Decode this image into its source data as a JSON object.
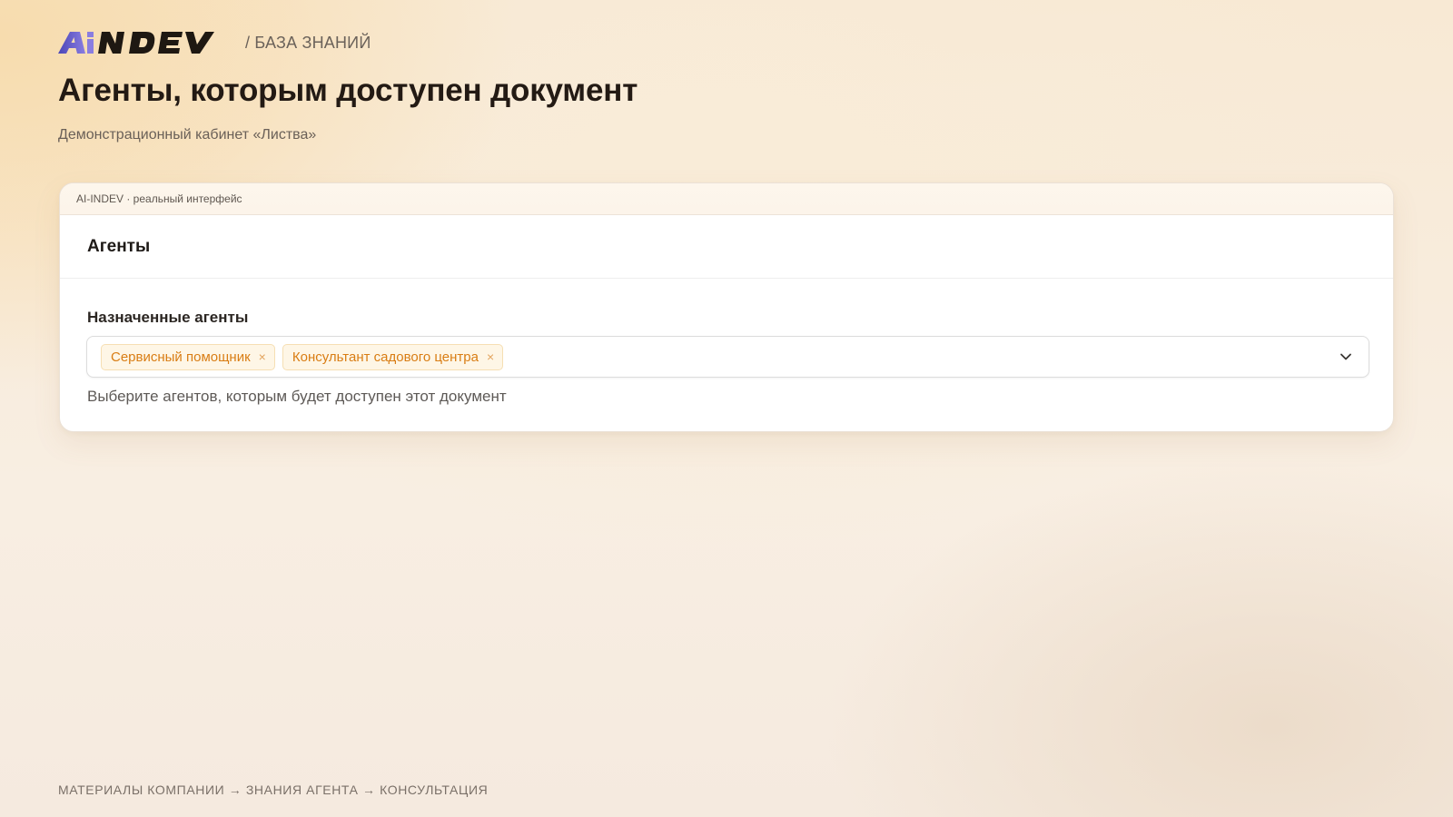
{
  "brand": {
    "logo_text": "AiNDEV",
    "section": "/ БАЗА ЗНАНИЙ"
  },
  "page": {
    "title": "Агенты, которым доступен документ",
    "subtitle": "Демонстрационный кабинет «Листва»"
  },
  "card": {
    "caption": "AI-INDEV · реальный интерфейс",
    "panel_title": "Агенты",
    "field_label": "Назначенные агенты",
    "selected_agents": [
      {
        "label": "Сервисный помощник",
        "remove": "×"
      },
      {
        "label": "Консультант садового центра",
        "remove": "×"
      }
    ],
    "help_text": "Выберите агентов, которым будет доступен этот документ"
  },
  "footer": {
    "path": "МАТЕРИАЛЫ КОМПАНИИ → ЗНАНИЯ АГЕНТА → КОНСУЛЬТАЦИЯ"
  },
  "icons": {
    "dropdown": "chevron-down-icon",
    "tag_remove": "close-icon"
  },
  "colors": {
    "accent": "#d97d14",
    "logo_primary": "#1e1812",
    "logo_accent": "#6a5acd"
  }
}
